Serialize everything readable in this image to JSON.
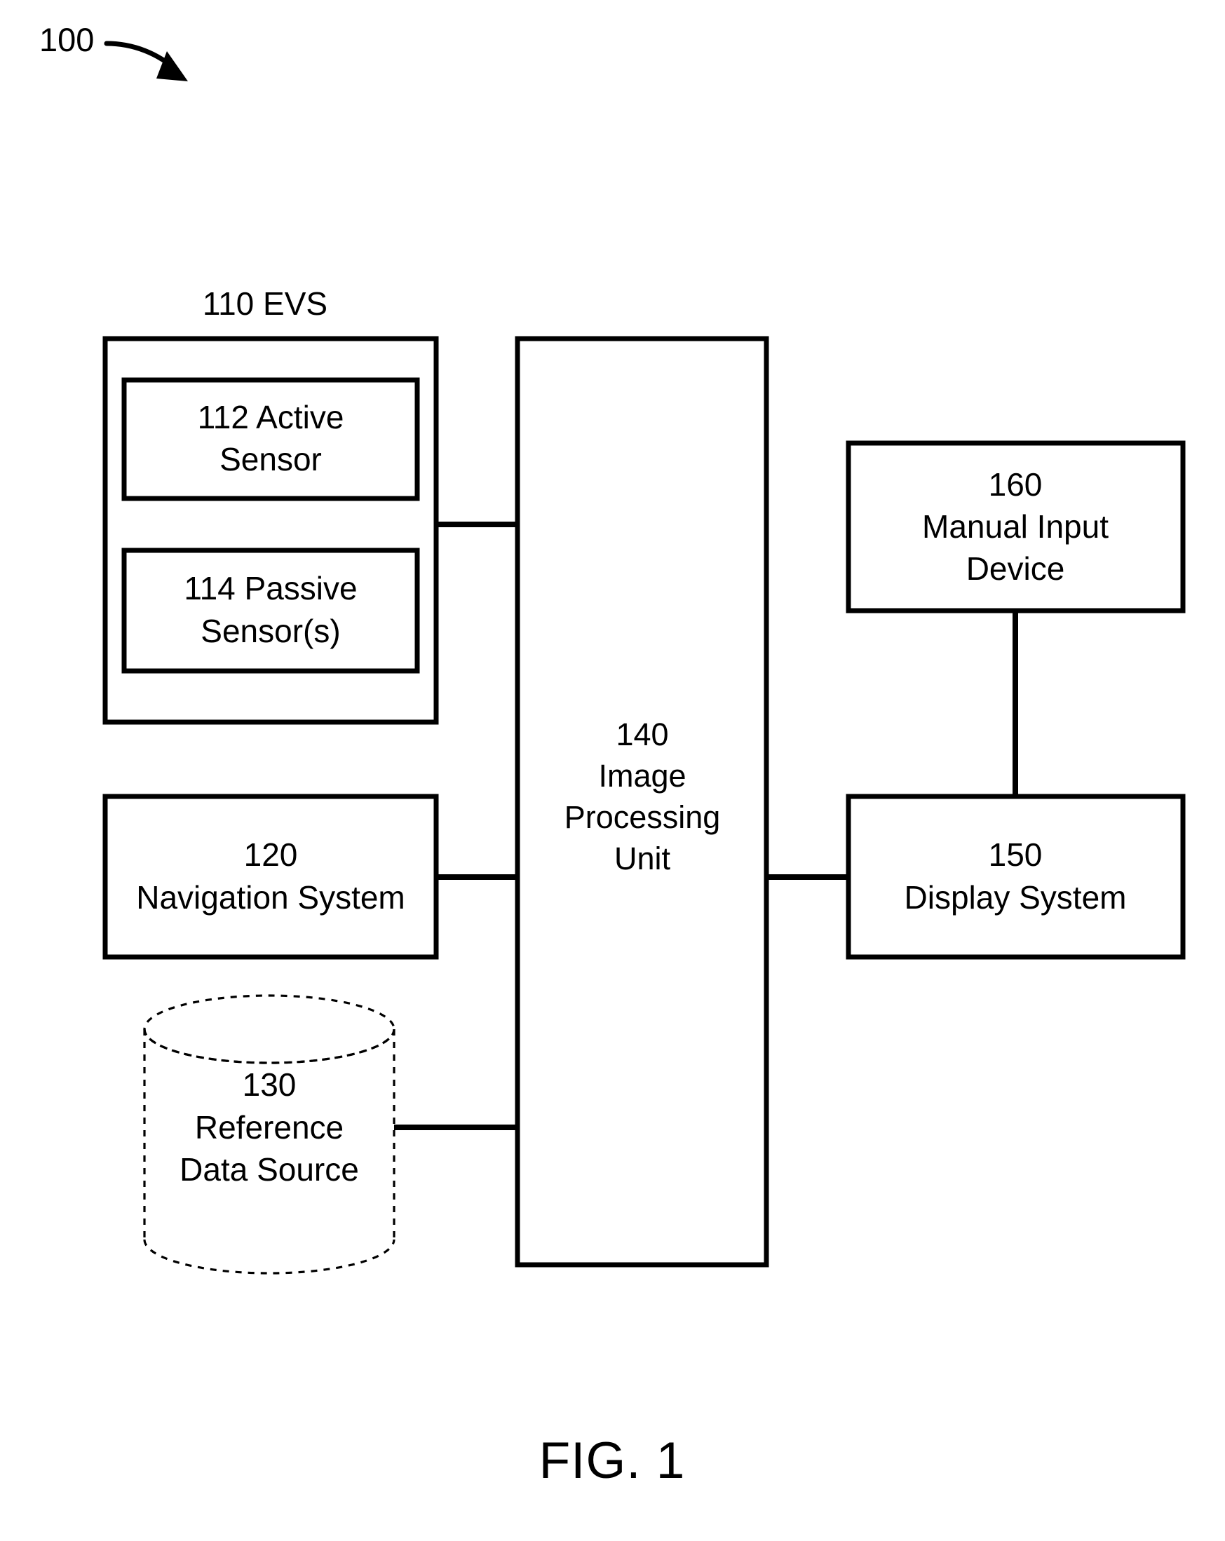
{
  "figure": {
    "number_label": "100",
    "caption": "FIG. 1"
  },
  "nodes": {
    "evs": {
      "title": "110 EVS",
      "children": {
        "active_sensor": {
          "lines": [
            "112 Active",
            "Sensor"
          ]
        },
        "passive_sensor": {
          "lines": [
            "114 Passive",
            "Sensor(s)"
          ]
        }
      }
    },
    "navigation_system": {
      "lines": [
        "120",
        "Navigation System"
      ]
    },
    "reference_data_source": {
      "lines": [
        "130",
        "Reference",
        "Data Source"
      ],
      "shape": "cylinder"
    },
    "image_processing_unit": {
      "lines": [
        "140",
        "Image",
        "Processing",
        "Unit"
      ]
    },
    "display_system": {
      "lines": [
        "150",
        "Display System"
      ]
    },
    "manual_input_device": {
      "lines": [
        "160",
        "Manual Input",
        "Device"
      ]
    }
  },
  "connections": [
    {
      "name": "evs-to-ipu",
      "from": "evs",
      "to": "image_processing_unit"
    },
    {
      "name": "navigation-to-ipu",
      "from": "navigation_system",
      "to": "image_processing_unit"
    },
    {
      "name": "reference-data-to-ipu",
      "from": "reference_data_source",
      "to": "image_processing_unit"
    },
    {
      "name": "ipu-to-display",
      "from": "image_processing_unit",
      "to": "display_system"
    },
    {
      "name": "manual-input-to-display",
      "from": "manual_input_device",
      "to": "display_system"
    }
  ],
  "style": {
    "line_color": "#000000",
    "background": "#ffffff"
  }
}
